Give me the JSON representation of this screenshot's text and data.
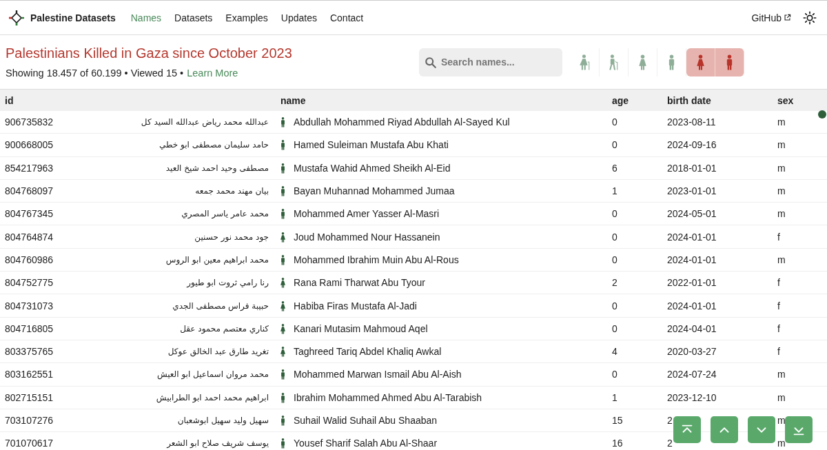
{
  "nav": {
    "brand": "Palestine Datasets",
    "links": [
      {
        "label": "Names",
        "selected": true
      },
      {
        "label": "Datasets",
        "selected": false
      },
      {
        "label": "Examples",
        "selected": false
      },
      {
        "label": "Updates",
        "selected": false
      },
      {
        "label": "Contact",
        "selected": false
      }
    ],
    "github": "GitHub"
  },
  "heading": {
    "title": "Palestinians Killed in Gaza since October 2023",
    "summary": "Showing 18.457 of 60.199 • Viewed 15 •",
    "link": "Learn More"
  },
  "search": {
    "placeholder": "Search names..."
  },
  "filters": [
    {
      "kind": "elder-female",
      "selected": false
    },
    {
      "kind": "elder-male",
      "selected": false
    },
    {
      "kind": "female",
      "selected": false
    },
    {
      "kind": "male",
      "selected": false
    },
    {
      "kind": "female",
      "selected": true
    },
    {
      "kind": "male",
      "selected": true
    }
  ],
  "table": {
    "columns": [
      "id",
      "name",
      "age",
      "birth date",
      "sex"
    ],
    "rows": [
      {
        "id": "906735832",
        "name_ar": "عبدالله محمد رياض عبدالله السيد كل",
        "name": "Abdullah Mohammed Riyad Abdullah Al-Sayed Kul",
        "age": "0",
        "birth_date": "2023-08-11",
        "sex": "m"
      },
      {
        "id": "900668005",
        "name_ar": "حامد سليمان مصطفى ابو خطي",
        "name": "Hamed Suleiman Mustafa Abu Khati",
        "age": "0",
        "birth_date": "2024-09-16",
        "sex": "m"
      },
      {
        "id": "854217963",
        "name_ar": "مصطفى وحيد احمد شيخ العيد",
        "name": "Mustafa Wahid Ahmed Sheikh Al-Eid",
        "age": "6",
        "birth_date": "2018-01-01",
        "sex": "m"
      },
      {
        "id": "804768097",
        "name_ar": "بيان مهند محمد جمعه",
        "name": "Bayan Muhannad Mohammed Jumaa",
        "age": "1",
        "birth_date": "2023-01-01",
        "sex": "m"
      },
      {
        "id": "804767345",
        "name_ar": "محمد عامر ياسر المصري",
        "name": "Mohammed Amer Yasser Al-Masri",
        "age": "0",
        "birth_date": "2024-05-01",
        "sex": "m"
      },
      {
        "id": "804764874",
        "name_ar": "جود محمد نور حسنين",
        "name": "Joud Mohammed Nour Hassanein",
        "age": "0",
        "birth_date": "2024-01-01",
        "sex": "f"
      },
      {
        "id": "804760986",
        "name_ar": "محمد ابراهيم معين ابو الروس",
        "name": "Mohammed Ibrahim Muin Abu Al-Rous",
        "age": "0",
        "birth_date": "2024-01-01",
        "sex": "m"
      },
      {
        "id": "804752775",
        "name_ar": "رنا رامي ثروت ابو طيور",
        "name": "Rana Rami Tharwat Abu Tyour",
        "age": "2",
        "birth_date": "2022-01-01",
        "sex": "f"
      },
      {
        "id": "804731073",
        "name_ar": "حبيبة فراس مصطفى الجدي",
        "name": "Habiba Firas Mustafa Al-Jadi",
        "age": "0",
        "birth_date": "2024-01-01",
        "sex": "f"
      },
      {
        "id": "804716805",
        "name_ar": "كناري معتصم محمود عقل",
        "name": "Kanari Mutasim Mahmoud Aqel",
        "age": "0",
        "birth_date": "2024-04-01",
        "sex": "f"
      },
      {
        "id": "803375765",
        "name_ar": "تغريد طارق عبد الخالق عوكل",
        "name": "Taghreed Tariq Abdel Khaliq Awkal",
        "age": "4",
        "birth_date": "2020-03-27",
        "sex": "f"
      },
      {
        "id": "803162551",
        "name_ar": "محمد مروان اسماعيل ابو العيش",
        "name": "Mohammed Marwan Ismail Abu Al-Aish",
        "age": "0",
        "birth_date": "2024-07-24",
        "sex": "m"
      },
      {
        "id": "802715151",
        "name_ar": "ابراهيم محمد احمد ابو الطرابيش",
        "name": "Ibrahim Mohammed Ahmed Abu Al-Tarabish",
        "age": "1",
        "birth_date": "2023-12-10",
        "sex": "m"
      },
      {
        "id": "703107276",
        "name_ar": "سهيل وليد سهيل ابوشعبان",
        "name": "Suhail Walid Suhail Abu Shaaban",
        "age": "15",
        "birth_date": "2",
        "sex": "m"
      },
      {
        "id": "701070617",
        "name_ar": "يوسف شريف صلاح ابو الشعر",
        "name": "Yousef Sharif Salah Abu Al-Shaar",
        "age": "16",
        "birth_date": "2",
        "sex": "m"
      }
    ]
  },
  "scroll_buttons": [
    {
      "kind": "top"
    },
    {
      "kind": "up"
    },
    {
      "kind": "down"
    },
    {
      "kind": "bottom"
    }
  ]
}
